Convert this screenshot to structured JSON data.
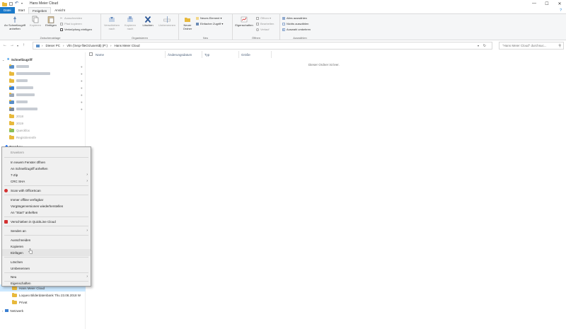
{
  "window": {
    "title": "Hans Meier Cloud",
    "controls": [
      "—",
      "☐",
      "✕"
    ]
  },
  "ribbon_tabs": [
    "Datei",
    "Start",
    "Freigeben",
    "Ansicht"
  ],
  "ribbon": {
    "clipboard": {
      "pin_label": "An Schnellzugriff anheften",
      "copy_label": "Kopieren",
      "paste_label": "Einfügen",
      "cut_label": "Ausschneiden",
      "copy_path_label": "Pfad kopieren",
      "paste_shortcut_label": "Verknüpfung einfügen",
      "group_label": "Zwischenablage"
    },
    "organize": {
      "move_label": "Verschieben nach",
      "copy_to_label": "Kopieren nach",
      "delete_label": "Löschen",
      "rename_label": "Umbenennen",
      "group_label": "Organisieren"
    },
    "new": {
      "new_folder_label": "Neuer Ordner",
      "new_item_label": "Neues Element ▾",
      "easy_access_label": "Einfacher Zugriff ▾",
      "group_label": "Neu"
    },
    "open": {
      "properties_label": "Eigenschaften",
      "open_label": "Öffnen ▾",
      "edit_label": "Bearbeiten",
      "history_label": "Verlauf",
      "group_label": "Öffnen"
    },
    "select": {
      "select_all_label": "Alles auswählen",
      "select_none_label": "Nichts auswählen",
      "invert_label": "Auswahl umkehren",
      "group_label": "Auswählen"
    }
  },
  "address": {
    "segments": [
      "Dieser PC",
      "›",
      "vfm (\\\\vsp-fileO1\\users$) (P:)",
      "›",
      "Hans Meier Cloud"
    ],
    "search_placeholder": "\"Hans Meier Cloud\" durchsuc..."
  },
  "nav": {
    "quick_access": "Schnellzugriff",
    "items": [
      "",
      "",
      "",
      "",
      "",
      "",
      "",
      "",
      "2018",
      "2019",
      "Queckfox",
      "Registrierenfe"
    ],
    "dropbox": "Dropbox",
    "cloud_folder": "Hans Meier Cloud",
    "loqueo": "Loqueo Bilderdatenbank Thu 23.08.2018 W",
    "privat": "Privat",
    "network": "Netzwerk"
  },
  "columns": [
    "Name",
    "Änderungsdatum",
    "Typ",
    "Größe"
  ],
  "empty_message": "Dieser Ordner ist leer.",
  "context_menu": {
    "items": [
      {
        "label": "Erweitern",
        "disabled": true
      },
      {
        "label": "In neuem Fenster öffnen"
      },
      {
        "label": "An Schnellzugriff anheften"
      },
      {
        "label": "7-Zip",
        "submenu": true
      },
      {
        "label": "CRC SHA",
        "submenu": true
      },
      {
        "label": "Scan with OfficeScan",
        "icon": "red"
      },
      {
        "label": "Immer offline verfügbar"
      },
      {
        "label": "Vorgängerversionen wiederherstellen"
      },
      {
        "label": "An \"Start\" anheften"
      },
      {
        "label": "Verschieben in QuickLine Cloud",
        "icon": "red"
      },
      {
        "label": "Senden an",
        "submenu": true
      },
      {
        "label": "Ausschneiden"
      },
      {
        "label": "Kopieren"
      },
      {
        "label": "Einfügen",
        "highlight": true
      },
      {
        "label": "Löschen"
      },
      {
        "label": "Umbenennen"
      },
      {
        "label": "Neu",
        "submenu": true
      },
      {
        "label": "Eigenschaften"
      }
    ]
  },
  "colors": {
    "file_tab": "#1979ca",
    "folder": "#e8b93c",
    "quick_access_star": "#1e88e5",
    "dropbox": "#0061fe",
    "delete_x": "#2b5797",
    "officescan": "#d32f2f"
  }
}
